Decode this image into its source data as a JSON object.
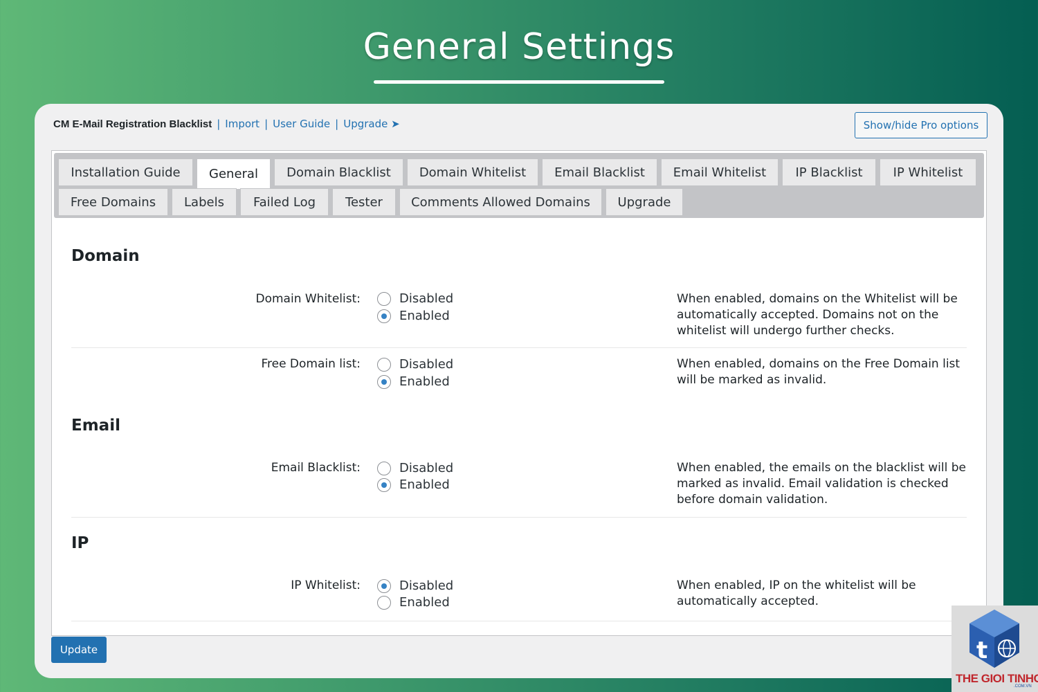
{
  "hero": {
    "title": "General Settings"
  },
  "header": {
    "plugin_name": "CM E-Mail Registration Blacklist",
    "links": [
      "Import",
      "User Guide",
      "Upgrade ➤"
    ],
    "pro_button": "Show/hide Pro options"
  },
  "tabs": {
    "row1": [
      "Installation Guide",
      "General",
      "Domain Blacklist",
      "Domain Whitelist",
      "Email Blacklist",
      "Email Whitelist",
      "IP Blacklist",
      "IP Whitelist"
    ],
    "row2": [
      "Free Domains",
      "Labels",
      "Failed Log",
      "Tester",
      "Comments Allowed Domains",
      "Upgrade"
    ],
    "active": "General"
  },
  "sections": {
    "domain": {
      "title": "Domain",
      "rows": [
        {
          "label": "Domain Whitelist:",
          "option_disabled": "Disabled",
          "option_enabled": "Enabled",
          "selected": "Enabled",
          "desc": "When enabled, domains on the Whitelist will be automatically accepted. Domains not on the whitelist will undergo further checks."
        },
        {
          "label": "Free Domain list:",
          "option_disabled": "Disabled",
          "option_enabled": "Enabled",
          "selected": "Enabled",
          "desc": "When enabled, domains on the Free Domain list will be marked as invalid."
        }
      ]
    },
    "email": {
      "title": "Email",
      "rows": [
        {
          "label": "Email Blacklist:",
          "option_disabled": "Disabled",
          "option_enabled": "Enabled",
          "selected": "Enabled",
          "desc": "When enabled, the emails on the blacklist will be marked as invalid. Email validation is checked before domain validation."
        }
      ]
    },
    "ip": {
      "title": "IP",
      "rows": [
        {
          "label": "IP Whitelist:",
          "option_disabled": "Disabled",
          "option_enabled": "Enabled",
          "selected": "Disabled",
          "desc": "When enabled, IP on the whitelist will be automatically accepted."
        }
      ]
    }
  },
  "footer": {
    "update_button": "Update"
  },
  "watermark": {
    "text": "THE GIOI TINHOC",
    "sub": ".COM.VN"
  },
  "colors": {
    "accent": "#2271b1",
    "radio_dot": "#3582c4",
    "watermark_red": "#c0272d"
  }
}
